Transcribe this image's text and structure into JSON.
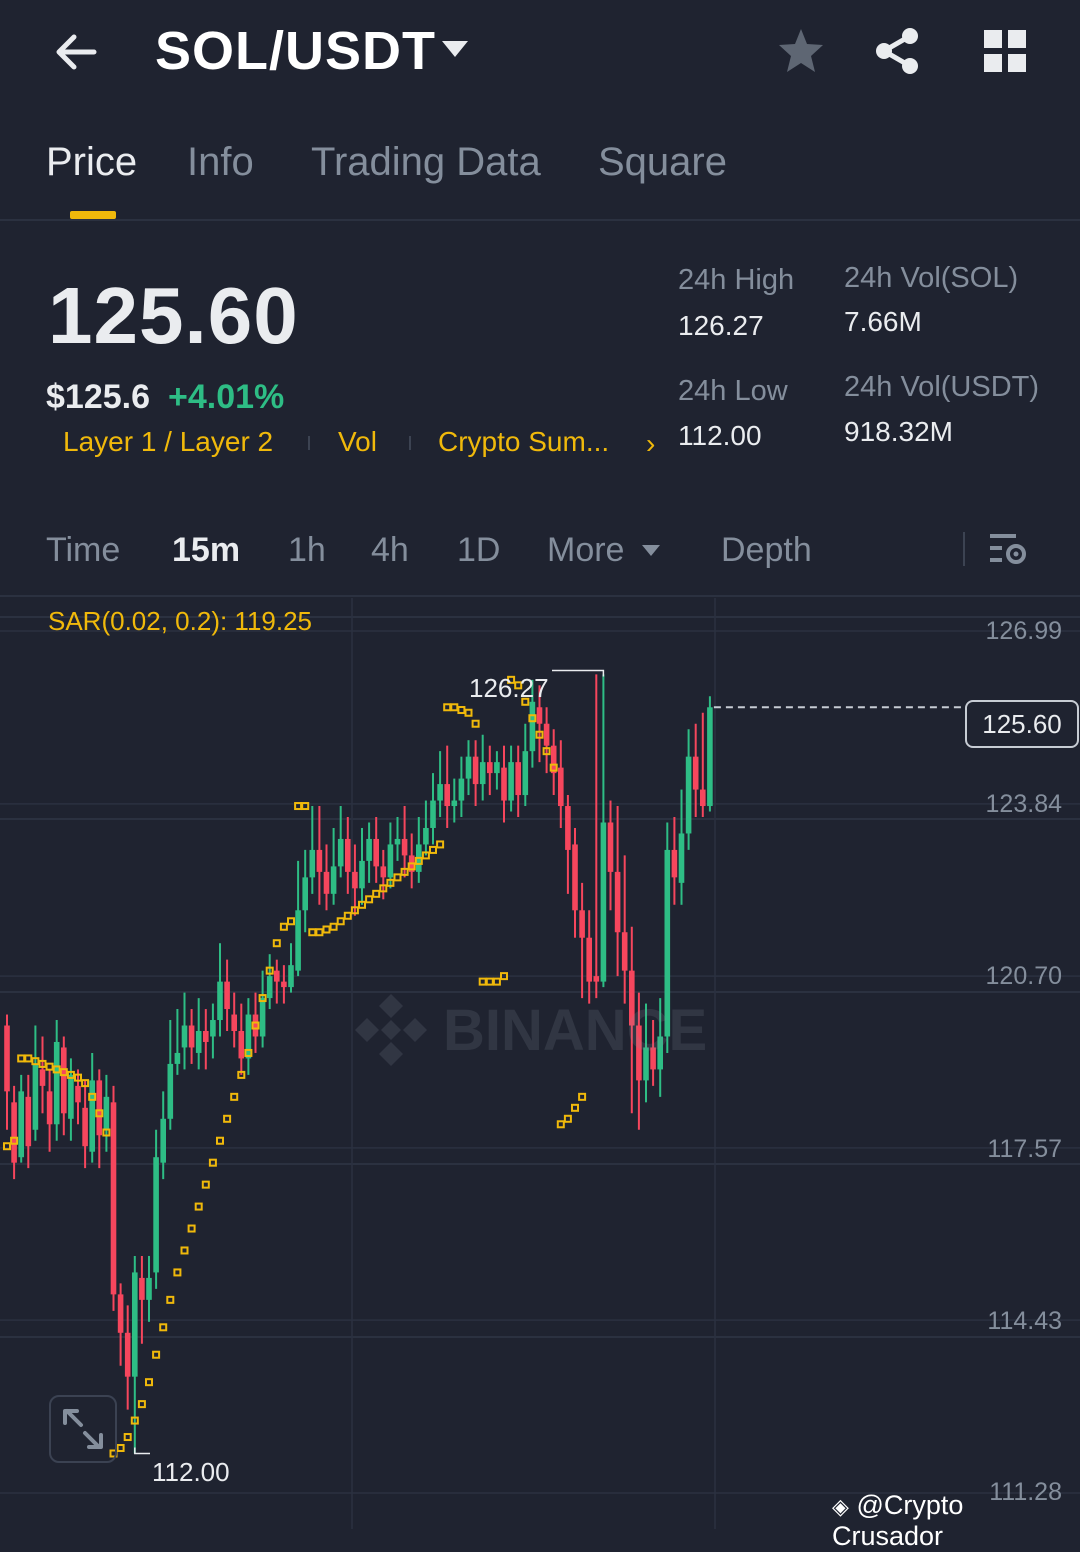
{
  "header": {
    "pair": "SOL/USDT",
    "icons": [
      "back-arrow-icon",
      "caret-down-icon",
      "star-icon",
      "share-icon",
      "grid-icon"
    ]
  },
  "tabs": [
    {
      "label": "Price",
      "active": true
    },
    {
      "label": "Info",
      "active": false
    },
    {
      "label": "Trading Data",
      "active": false
    },
    {
      "label": "Square",
      "active": false
    }
  ],
  "ticker": {
    "last_price": "125.60",
    "usd_price": "$125.6",
    "change_pct": "+4.01%",
    "tags": [
      "Layer 1 / Layer 2",
      "Vol",
      "Crypto Sum..."
    ],
    "high_label": "24h High",
    "high_value": "126.27",
    "low_label": "24h Low",
    "low_value": "112.00",
    "vol_base_label": "24h Vol(SOL)",
    "vol_base_value": "7.66M",
    "vol_quote_label": "24h Vol(USDT)",
    "vol_quote_value": "918.32M"
  },
  "timeframes": {
    "items": [
      {
        "label": "Time",
        "active": false
      },
      {
        "label": "15m",
        "active": true
      },
      {
        "label": "1h",
        "active": false
      },
      {
        "label": "4h",
        "active": false
      },
      {
        "label": "1D",
        "active": false
      },
      {
        "label": "More",
        "active": false
      },
      {
        "label": "Depth",
        "active": false
      }
    ]
  },
  "colors": {
    "background": "#1f2330",
    "accent": "#f0b90b",
    "up": "#2ebd85",
    "down": "#f6465d",
    "muted": "#848e9c"
  },
  "chart_data": {
    "type": "candlestick",
    "indicator": "SAR(0.02, 0.2): 119.25",
    "y_ticks": [
      "126.99",
      "123.84",
      "120.70",
      "117.57",
      "114.43",
      "111.28"
    ],
    "ylim": [
      111.28,
      126.99
    ],
    "current_price": "125.60",
    "high_marker": "126.27",
    "low_marker": "112.00",
    "watermark": "BINANCE",
    "candles": [
      [
        119.8,
        118.6,
        117.9,
        120.0
      ],
      [
        118.4,
        117.3,
        117.0,
        118.7
      ],
      [
        117.4,
        118.6,
        117.3,
        118.9
      ],
      [
        118.5,
        117.6,
        117.2,
        118.9
      ],
      [
        117.9,
        119.1,
        117.7,
        119.8
      ],
      [
        119.0,
        118.7,
        118.2,
        119.6
      ],
      [
        118.6,
        118.0,
        117.5,
        119.0
      ],
      [
        118.0,
        119.5,
        117.7,
        119.9
      ],
      [
        119.4,
        118.2,
        117.8,
        119.6
      ],
      [
        118.1,
        118.9,
        117.7,
        119.2
      ],
      [
        118.7,
        118.4,
        118.0,
        119.0
      ],
      [
        118.3,
        117.6,
        117.2,
        118.8
      ],
      [
        117.5,
        118.8,
        117.3,
        119.3
      ],
      [
        118.8,
        117.8,
        117.2,
        119.0
      ],
      [
        117.9,
        118.5,
        117.5,
        118.9
      ],
      [
        118.4,
        114.9,
        114.6,
        118.7
      ],
      [
        114.9,
        114.2,
        113.6,
        115.1
      ],
      [
        114.2,
        113.4,
        112.8,
        114.7
      ],
      [
        113.4,
        115.3,
        112.0,
        115.6
      ],
      [
        115.2,
        114.8,
        114.0,
        115.6
      ],
      [
        114.8,
        115.2,
        114.4,
        115.6
      ],
      [
        115.3,
        117.4,
        115.0,
        117.9
      ],
      [
        117.3,
        118.1,
        117.0,
        118.6
      ],
      [
        118.1,
        119.1,
        117.9,
        119.9
      ],
      [
        119.1,
        119.3,
        118.9,
        120.1
      ],
      [
        119.4,
        119.8,
        119.0,
        120.4
      ],
      [
        119.8,
        119.4,
        119.1,
        120.1
      ],
      [
        119.3,
        119.7,
        119.0,
        120.3
      ],
      [
        119.7,
        119.5,
        119.0,
        120.1
      ],
      [
        119.6,
        119.9,
        119.2,
        120.2
      ],
      [
        119.9,
        120.6,
        119.6,
        121.3
      ],
      [
        120.6,
        120.1,
        119.7,
        121.0
      ],
      [
        120.0,
        119.7,
        119.4,
        120.4
      ],
      [
        119.7,
        119.2,
        118.9,
        120.2
      ],
      [
        119.2,
        120.0,
        118.9,
        120.3
      ],
      [
        120.0,
        119.6,
        119.3,
        120.4
      ],
      [
        119.6,
        120.3,
        119.4,
        120.8
      ],
      [
        120.3,
        120.7,
        120.1,
        121.1
      ],
      [
        120.8,
        120.6,
        120.2,
        121.0
      ],
      [
        120.6,
        120.5,
        120.2,
        120.9
      ],
      [
        120.5,
        120.9,
        120.4,
        121.3
      ],
      [
        120.8,
        121.9,
        120.7,
        122.8
      ],
      [
        121.9,
        122.5,
        121.5,
        123.0
      ],
      [
        122.5,
        123.0,
        122.2,
        123.8
      ],
      [
        123.0,
        122.6,
        122.0,
        123.8
      ],
      [
        122.6,
        122.2,
        121.9,
        123.1
      ],
      [
        122.2,
        122.7,
        122.0,
        123.4
      ],
      [
        122.7,
        123.2,
        122.5,
        123.8
      ],
      [
        123.2,
        122.6,
        122.2,
        123.6
      ],
      [
        122.6,
        122.3,
        121.8,
        123.1
      ],
      [
        122.3,
        122.8,
        122.0,
        123.4
      ],
      [
        122.8,
        123.2,
        122.4,
        123.5
      ],
      [
        123.2,
        122.7,
        122.4,
        123.6
      ],
      [
        122.7,
        122.5,
        122.1,
        123.0
      ],
      [
        122.5,
        123.1,
        122.3,
        123.5
      ],
      [
        123.1,
        123.2,
        122.8,
        123.6
      ],
      [
        123.2,
        122.9,
        122.5,
        123.8
      ],
      [
        122.9,
        122.6,
        122.3,
        123.3
      ],
      [
        122.6,
        123.1,
        122.4,
        123.6
      ],
      [
        123.1,
        123.4,
        122.9,
        123.9
      ],
      [
        123.4,
        123.9,
        123.1,
        124.4
      ],
      [
        123.9,
        124.2,
        123.6,
        124.8
      ],
      [
        124.2,
        123.8,
        123.4,
        124.9
      ],
      [
        123.8,
        123.9,
        123.5,
        124.3
      ],
      [
        123.9,
        124.3,
        123.6,
        124.7
      ],
      [
        124.3,
        124.7,
        124.0,
        125.0
      ],
      [
        124.7,
        124.2,
        123.8,
        125.0
      ],
      [
        124.2,
        124.6,
        123.9,
        125.1
      ],
      [
        124.6,
        124.4,
        124.0,
        124.9
      ],
      [
        124.4,
        124.6,
        124.1,
        124.8
      ],
      [
        124.5,
        123.9,
        123.5,
        124.9
      ],
      [
        123.9,
        124.6,
        123.7,
        124.9
      ],
      [
        124.6,
        124.0,
        123.6,
        124.9
      ],
      [
        124.0,
        124.8,
        123.8,
        125.3
      ],
      [
        124.8,
        125.7,
        124.5,
        126.1
      ],
      [
        125.6,
        125.3,
        124.6,
        126.0
      ],
      [
        125.3,
        124.9,
        124.4,
        125.6
      ],
      [
        124.9,
        124.4,
        124.0,
        125.2
      ],
      [
        124.5,
        123.8,
        123.4,
        125.0
      ],
      [
        123.8,
        123.0,
        122.2,
        124.0
      ],
      [
        123.1,
        121.9,
        121.4,
        123.4
      ],
      [
        121.9,
        121.4,
        120.3,
        122.4
      ],
      [
        121.4,
        120.6,
        120.2,
        121.9
      ],
      [
        120.7,
        120.6,
        120.3,
        126.2
      ],
      [
        120.6,
        123.5,
        120.5,
        126.2
      ],
      [
        123.5,
        122.6,
        121.9,
        123.9
      ],
      [
        122.6,
        121.5,
        120.7,
        123.8
      ],
      [
        121.5,
        120.8,
        120.2,
        122.9
      ],
      [
        120.8,
        119.8,
        118.2,
        121.6
      ],
      [
        119.8,
        118.8,
        117.9,
        120.4
      ],
      [
        118.8,
        119.4,
        118.4,
        120.2
      ],
      [
        119.4,
        119.0,
        118.7,
        119.9
      ],
      [
        119.0,
        119.6,
        118.5,
        120.3
      ],
      [
        119.6,
        123.0,
        119.3,
        123.5
      ],
      [
        123.0,
        122.5,
        122.0,
        123.6
      ],
      [
        122.4,
        123.3,
        122.0,
        124.1
      ],
      [
        123.3,
        124.7,
        123.0,
        125.2
      ],
      [
        124.7,
        124.1,
        123.6,
        125.3
      ],
      [
        124.1,
        123.8,
        123.6,
        125.5
      ],
      [
        123.8,
        125.6,
        123.7,
        125.8
      ]
    ],
    "sar": [
      [
        0,
        117.6
      ],
      [
        1,
        117.7
      ],
      [
        2,
        119.2
      ],
      [
        3,
        119.2
      ],
      [
        4,
        119.15
      ],
      [
        5,
        119.1
      ],
      [
        6,
        119.05
      ],
      [
        7,
        119.0
      ],
      [
        8,
        118.95
      ],
      [
        9,
        118.9
      ],
      [
        10,
        118.85
      ],
      [
        11,
        118.75
      ],
      [
        12,
        118.5
      ],
      [
        13,
        118.2
      ],
      [
        14,
        117.85
      ],
      [
        15,
        112.0
      ],
      [
        16,
        112.1
      ],
      [
        17,
        112.3
      ],
      [
        18,
        112.6
      ],
      [
        19,
        112.9
      ],
      [
        20,
        113.3
      ],
      [
        21,
        113.8
      ],
      [
        22,
        114.3
      ],
      [
        23,
        114.8
      ],
      [
        24,
        115.3
      ],
      [
        25,
        115.7
      ],
      [
        26,
        116.1
      ],
      [
        27,
        116.5
      ],
      [
        28,
        116.9
      ],
      [
        29,
        117.3
      ],
      [
        30,
        117.7
      ],
      [
        31,
        118.1
      ],
      [
        32,
        118.5
      ],
      [
        33,
        118.9
      ],
      [
        34,
        119.3
      ],
      [
        35,
        119.8
      ],
      [
        36,
        120.3
      ],
      [
        37,
        120.8
      ],
      [
        38,
        121.3
      ],
      [
        39,
        121.6
      ],
      [
        40,
        121.7
      ],
      [
        41,
        123.8
      ],
      [
        42,
        123.8
      ],
      [
        43,
        121.5
      ],
      [
        44,
        121.5
      ],
      [
        45,
        121.55
      ],
      [
        46,
        121.6
      ],
      [
        47,
        121.7
      ],
      [
        48,
        121.8
      ],
      [
        49,
        121.9
      ],
      [
        50,
        122.0
      ],
      [
        51,
        122.1
      ],
      [
        52,
        122.2
      ],
      [
        53,
        122.3
      ],
      [
        54,
        122.4
      ],
      [
        55,
        122.5
      ],
      [
        56,
        122.6
      ],
      [
        57,
        122.7
      ],
      [
        58,
        122.8
      ],
      [
        59,
        122.9
      ],
      [
        60,
        123.0
      ],
      [
        61,
        123.1
      ],
      [
        62,
        125.6
      ],
      [
        63,
        125.6
      ],
      [
        64,
        125.55
      ],
      [
        65,
        125.5
      ],
      [
        66,
        125.3
      ],
      [
        67,
        120.6
      ],
      [
        68,
        120.6
      ],
      [
        69,
        120.6
      ],
      [
        70,
        120.7
      ],
      [
        71,
        126.1
      ],
      [
        72,
        126.0
      ],
      [
        73,
        125.7
      ],
      [
        74,
        125.4
      ],
      [
        75,
        125.1
      ],
      [
        76,
        124.8
      ],
      [
        77,
        124.5
      ],
      [
        78,
        118.0
      ],
      [
        79,
        118.1
      ],
      [
        80,
        118.3
      ],
      [
        81,
        118.5
      ]
    ]
  },
  "credit": "@Crypto Crusador"
}
